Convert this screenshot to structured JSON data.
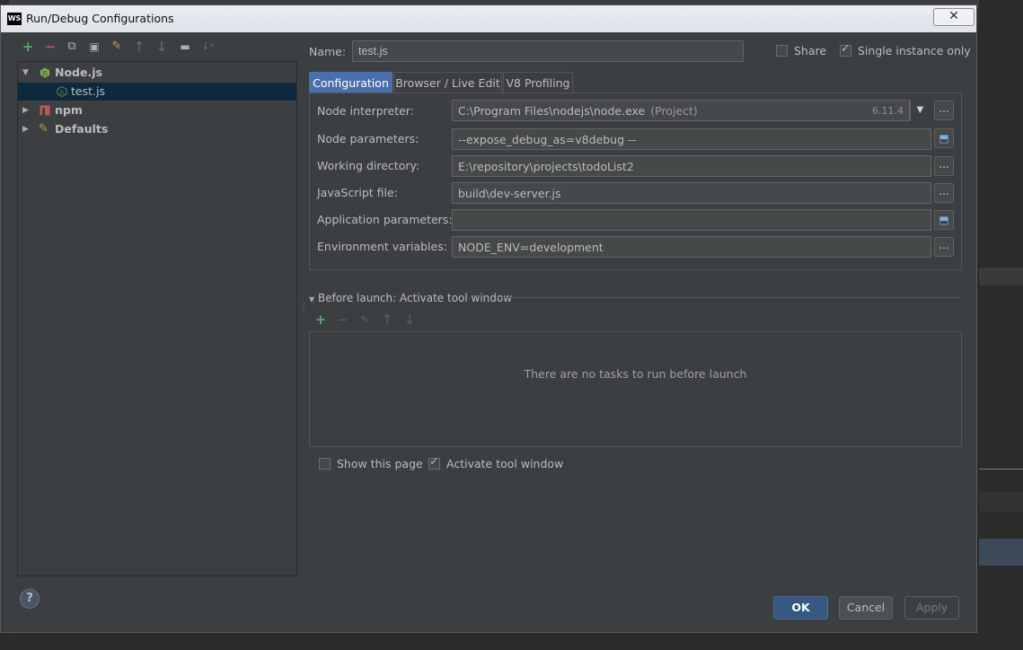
{
  "window": {
    "title": "Run/Debug Configurations",
    "app_logo": "WS",
    "close_glyph": "✕"
  },
  "toolbar": {
    "add": "+",
    "remove": "−",
    "copy": "⧉",
    "save": "▣",
    "edit_defaults": "✎",
    "move_up": "↑",
    "move_down": "↓",
    "folder": "▬",
    "sort": "↓ᵃ"
  },
  "tree": [
    {
      "label": "Node.js",
      "bold": true,
      "expanded": true,
      "icon": "nodejs-icon"
    },
    {
      "label": "test.js",
      "bold": false,
      "selected": true,
      "icon": "nodejs-file-icon"
    },
    {
      "label": "npm",
      "bold": true,
      "expanded": false,
      "icon": "npm-icon"
    },
    {
      "label": "Defaults",
      "bold": true,
      "expanded": false,
      "icon": "wrench-icon"
    }
  ],
  "name": {
    "label": "Name:",
    "value": "test.js"
  },
  "share": {
    "label": "Share",
    "checked": false
  },
  "single_instance": {
    "label": "Single instance only",
    "checked": true
  },
  "tabs": [
    "Configuration",
    "Browser / Live Edit",
    "V8 Profiling"
  ],
  "fields": {
    "node_interpreter": {
      "label": "Node interpreter:",
      "value": "C:\\Program Files\\nodejs\\node.exe",
      "hint": "(Project)",
      "version": "6.11.4"
    },
    "node_parameters": {
      "label": "Node parameters:",
      "value": "--expose_debug_as=v8debug --"
    },
    "working_directory": {
      "label": "Working directory:",
      "value": "E:\\repository\\projects\\todoList2"
    },
    "javascript_file": {
      "label": "JavaScript file:",
      "value": "build\\dev-server.js"
    },
    "application_parameters": {
      "label": "Application parameters:",
      "value": ""
    },
    "environment_variables": {
      "label": "Environment variables:",
      "value": "NODE_ENV=development"
    }
  },
  "before_launch": {
    "title": "Before launch: Activate tool window",
    "empty_text": "There are no tasks to run before launch"
  },
  "show_this_page": {
    "label": "Show this page",
    "checked": false
  },
  "activate_tool_window": {
    "label": "Activate tool window",
    "checked": true
  },
  "buttons": {
    "ok": "OK",
    "cancel": "Cancel",
    "apply": "Apply",
    "help": "?"
  },
  "ellipsis": "...",
  "colors": {
    "accent": "#4b6eaf",
    "ok_button": "#365880",
    "add_green": "#59a869",
    "remove_red": "#c75450"
  }
}
